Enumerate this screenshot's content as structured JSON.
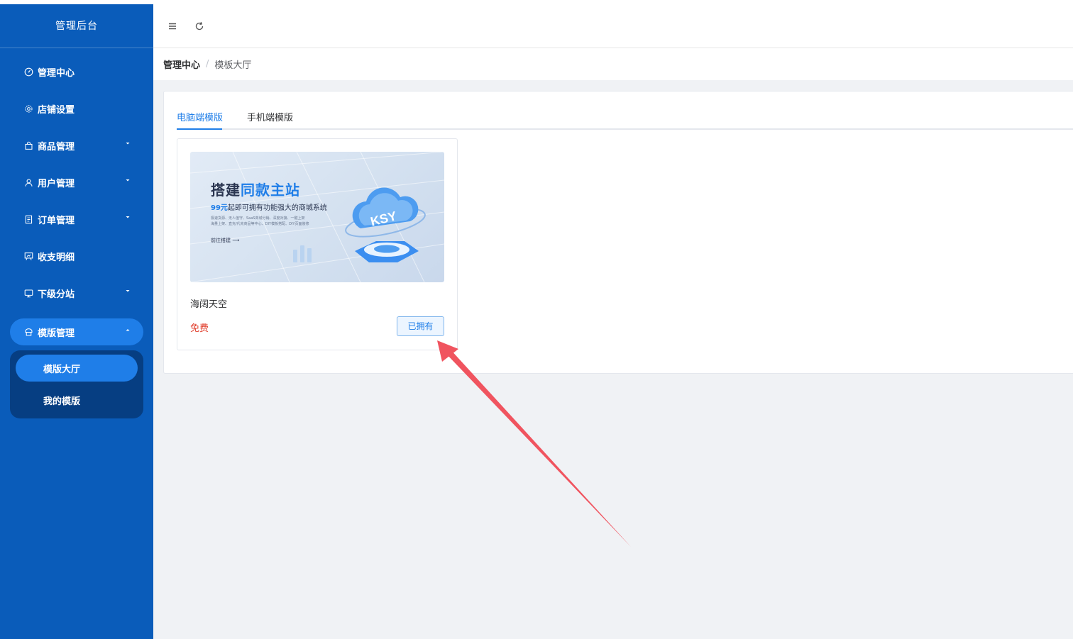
{
  "sidebar": {
    "title": "管理后台",
    "items": [
      {
        "label": "管理中心",
        "icon": "dashboard-icon",
        "has_caret": false
      },
      {
        "label": "店铺设置",
        "icon": "gear-icon",
        "has_caret": false
      },
      {
        "label": "商品管理",
        "icon": "bag-icon",
        "has_caret": true
      },
      {
        "label": "用户管理",
        "icon": "user-icon",
        "has_caret": true
      },
      {
        "label": "订单管理",
        "icon": "document-icon",
        "has_caret": true
      },
      {
        "label": "收支明细",
        "icon": "presentation-icon",
        "has_caret": false
      },
      {
        "label": "下级分站",
        "icon": "monitor-icon",
        "has_caret": true
      },
      {
        "label": "模版管理",
        "icon": "template-icon",
        "has_caret": true,
        "expanded": true
      }
    ],
    "submenu": [
      {
        "label": "模版大厅",
        "active": true
      },
      {
        "label": "我的模版",
        "active": false
      }
    ]
  },
  "header": {
    "menu_toggle_icon": "hamburger-icon",
    "refresh_icon": "refresh-icon"
  },
  "breadcrumb": {
    "root": "管理中心",
    "separator": "/",
    "current": "模板大厅"
  },
  "tabs": [
    {
      "label": "电脑端模版",
      "active": true
    },
    {
      "label": "手机端模版",
      "active": false
    }
  ],
  "template_card": {
    "thumbnail": {
      "title_prefix": "搭建",
      "title_highlight": "同款主站",
      "subtitle_highlight": "99元",
      "subtitle": "起即可拥有功能强大的商城系统",
      "line1": "极速货源、无人值守、SaaS商城分销、深度对接、一键上架",
      "line2": "海量上架、直充/代充商品等中心、DIY模板搭配、DIY页面装修",
      "link": "前往搭建 ⟶",
      "logo": "KSY"
    },
    "name": "海阔天空",
    "price": "免费",
    "button": "已拥有"
  },
  "colors": {
    "sidebar_bg": "#0a5cba",
    "accent": "#1f7ee8",
    "submenu_bg": "#063e82",
    "price": "#e03c2a",
    "annotation_arrow": "#f0545f"
  }
}
